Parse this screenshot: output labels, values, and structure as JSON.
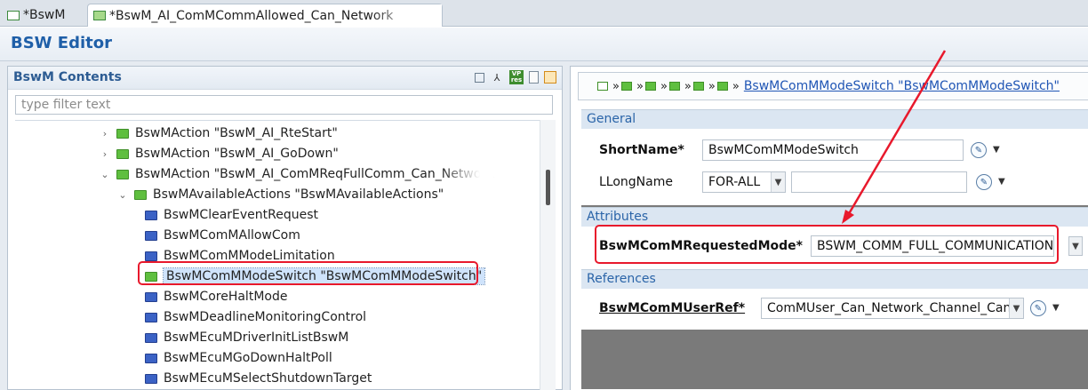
{
  "tabs": [
    {
      "label": "*BswM",
      "active": false
    },
    {
      "label": "*BswM_AI_ComMCommAllowed_Can_Network",
      "active": true
    }
  ],
  "editor_title": "BSW Editor",
  "left_panel": {
    "title": "BswM Contents",
    "header_icons": [
      "collapse-all-icon",
      "hierarchy-icon",
      "vp-res-icon",
      "document-icon",
      "grid-icon"
    ],
    "filter_placeholder": "type filter text",
    "tree": [
      {
        "label": "BswMAction \"BswM_AI_RteStart\"",
        "expander": "collapsed",
        "folder": "green"
      },
      {
        "label": "BswMAction \"BswM_AI_GoDown\"",
        "expander": "collapsed",
        "folder": "green"
      },
      {
        "label": "BswMAction \"BswM_AI_ComMReqFullComm_Can_Network",
        "expander": "expanded",
        "folder": "green"
      },
      {
        "label": "BswMAvailableActions \"BswMAvailableActions\"",
        "expander": "expanded",
        "folder": "green"
      },
      {
        "label": "BswMClearEventRequest",
        "expander": "",
        "folder": "blue"
      },
      {
        "label": "BswMComMAllowCom",
        "expander": "",
        "folder": "blue"
      },
      {
        "label": "BswMComMModeLimitation",
        "expander": "",
        "folder": "blue"
      },
      {
        "label": "BswMComMModeSwitch \"BswMComMModeSwitch\"",
        "expander": "",
        "folder": "green",
        "selected": true
      },
      {
        "label": "BswMCoreHaltMode",
        "expander": "",
        "folder": "blue"
      },
      {
        "label": "BswMDeadlineMonitoringControl",
        "expander": "",
        "folder": "blue"
      },
      {
        "label": "BswMEcuMDriverInitListBswM",
        "expander": "",
        "folder": "blue"
      },
      {
        "label": "BswMEcuMGoDownHaltPoll",
        "expander": "",
        "folder": "blue"
      },
      {
        "label": "BswMEcuMSelectShutdownTarget",
        "expander": "",
        "folder": "blue"
      }
    ]
  },
  "right_panel": {
    "breadcrumb_link": "BswMComMModeSwitch \"BswMComMModeSwitch\"",
    "breadcrumb_sep": "»",
    "sections": {
      "general": {
        "title": "General",
        "short_name_label": "ShortName*",
        "short_name_value": "BswMComMModeSwitch",
        "long_name_label": "LLongName",
        "long_name_lang": "FOR-ALL",
        "long_name_value": ""
      },
      "attributes": {
        "title": "Attributes",
        "requested_mode_label": "BswMComMRequestedMode*",
        "requested_mode_value": "BSWM_COMM_FULL_COMMUNICATION"
      },
      "references": {
        "title": "References",
        "user_ref_label": "BswMComMUserRef*",
        "user_ref_value": "ComMUser_Can_Network_Channel_Can_N"
      }
    }
  },
  "colors": {
    "accent": "#1f5fa8",
    "highlight_red": "#e8192c",
    "folder_green": "#5fbf3f",
    "folder_blue": "#3b62c5"
  },
  "glyphs": {
    "chevron_collapsed": "›",
    "chevron_expanded": "⌄",
    "dropdown": "▼",
    "control": "✎"
  }
}
